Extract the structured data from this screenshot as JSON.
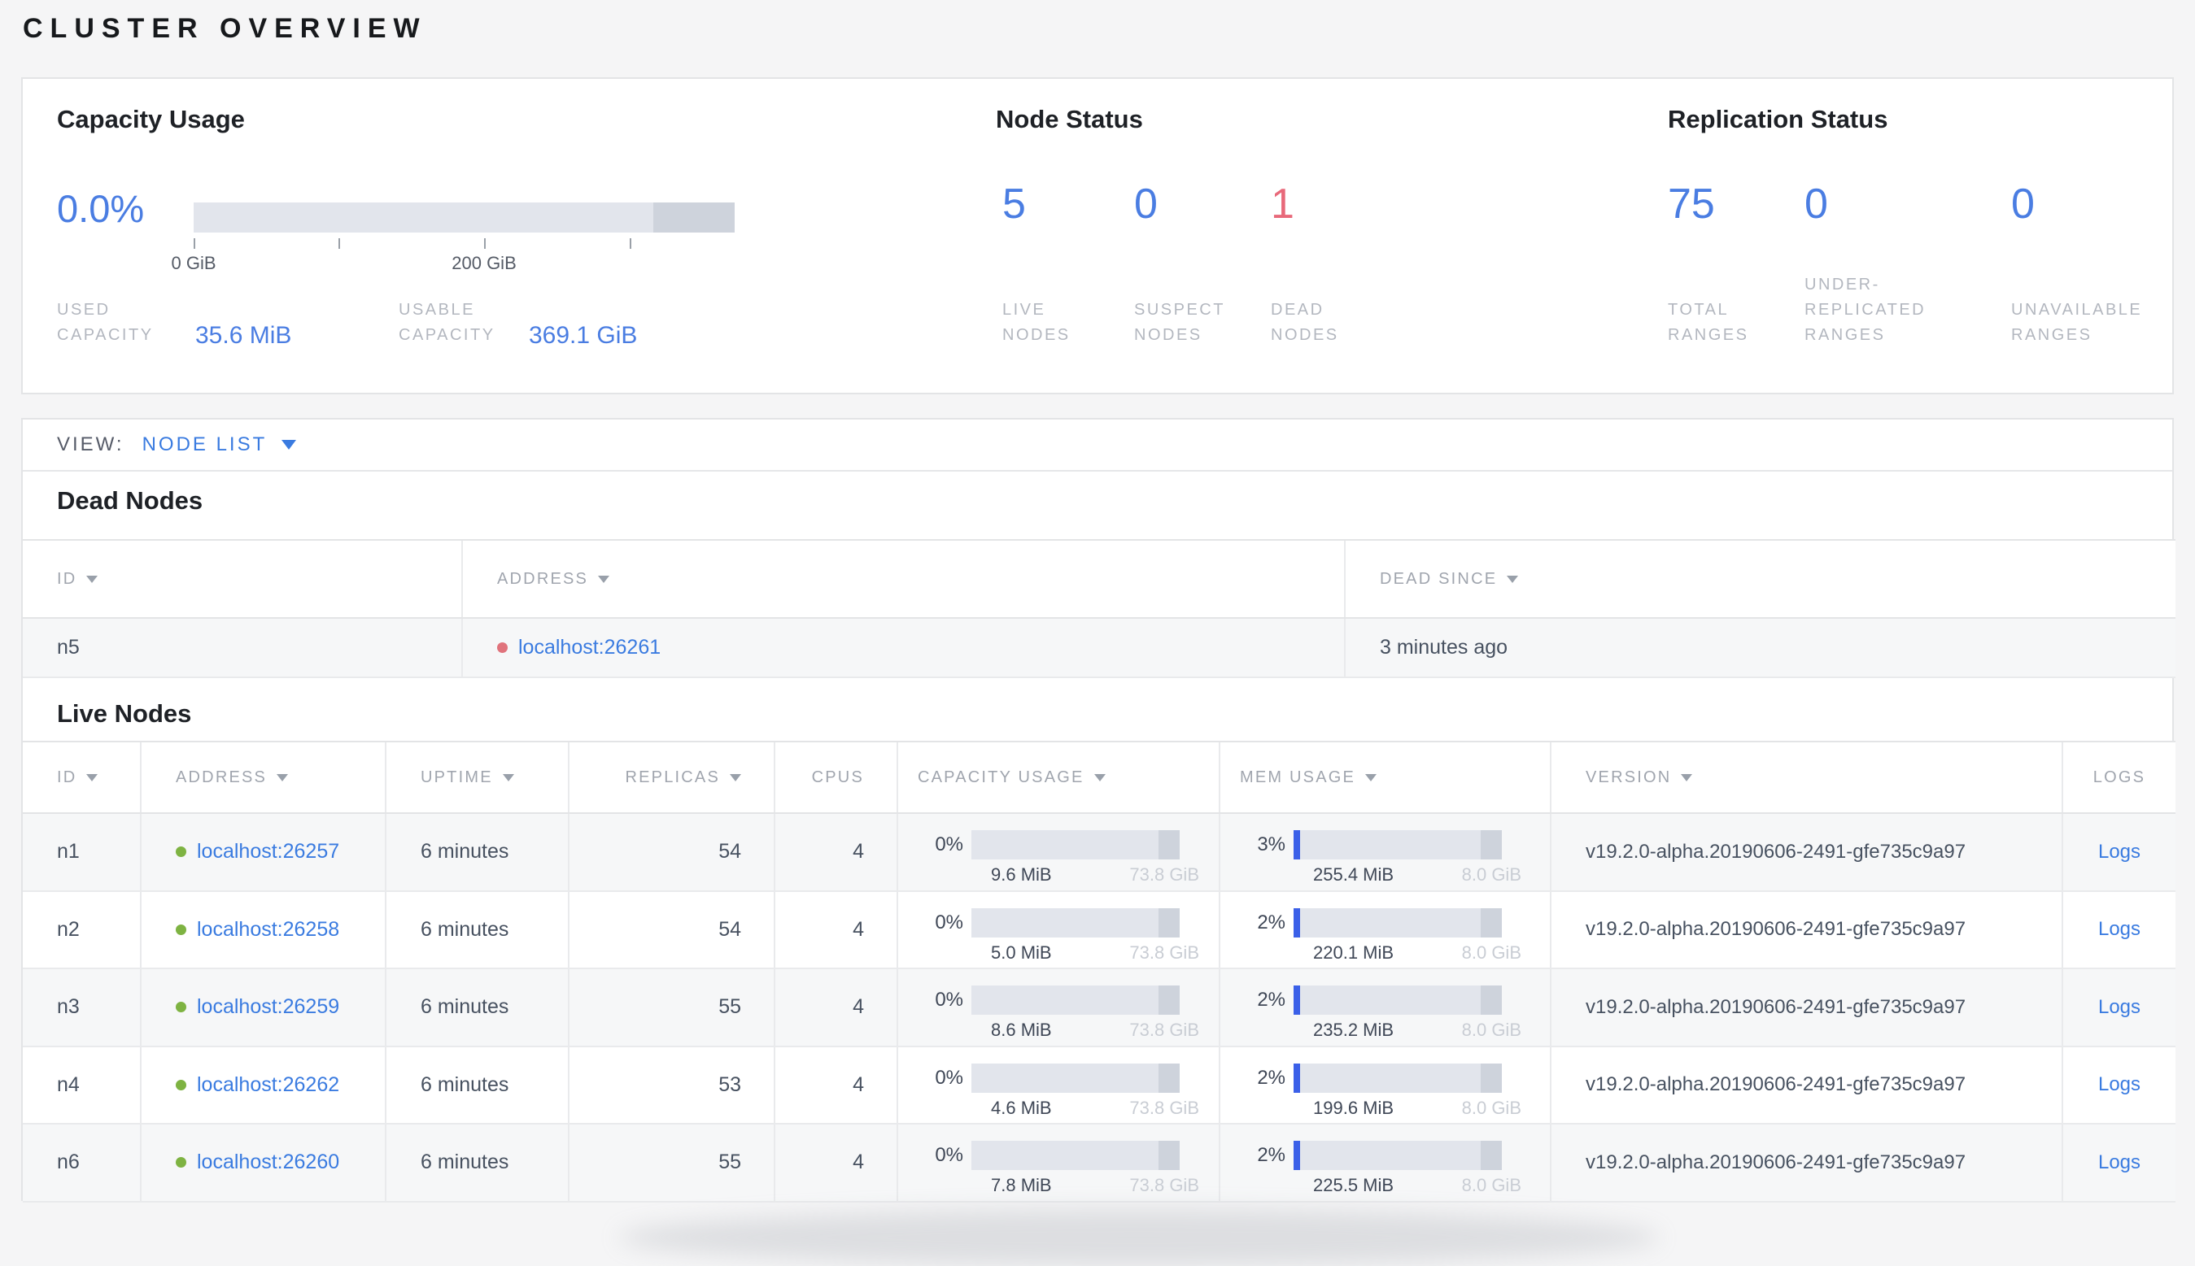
{
  "colors": {
    "accent_blue": "#4a7de2",
    "link_blue": "#3a7be0",
    "danger_red": "#e8697a",
    "live_green": "#7eb342",
    "dead_red": "#e0737c"
  },
  "page_title": "CLUSTER OVERVIEW",
  "summary": {
    "capacity": {
      "title": "Capacity Usage",
      "percent": "0.0%",
      "tick_labels": [
        "0 GiB",
        "200 GiB"
      ],
      "stats": [
        {
          "label": "USED CAPACITY",
          "value": "35.6 MiB"
        },
        {
          "label": "USABLE CAPACITY",
          "value": "369.1 GiB"
        }
      ]
    },
    "node_status": {
      "title": "Node Status",
      "stats": [
        {
          "value": "5",
          "label": "LIVE NODES"
        },
        {
          "value": "0",
          "label": "SUSPECT NODES"
        },
        {
          "value": "1",
          "label": "DEAD NODES"
        }
      ]
    },
    "replication": {
      "title": "Replication Status",
      "stats": [
        {
          "value": "75",
          "label": "TOTAL RANGES"
        },
        {
          "value": "0",
          "label": "UNDER-REPLICATED RANGES"
        },
        {
          "value": "0",
          "label": "UNAVAILABLE RANGES"
        }
      ]
    }
  },
  "view_bar": {
    "label": "VIEW:",
    "selected": "NODE LIST"
  },
  "dead_nodes": {
    "title": "Dead Nodes",
    "columns": [
      "ID",
      "ADDRESS",
      "DEAD SINCE"
    ],
    "rows": [
      {
        "id": "n5",
        "address": "localhost:26261",
        "dead_since": "3 minutes ago"
      }
    ]
  },
  "live_nodes": {
    "title": "Live Nodes",
    "columns": [
      "ID",
      "ADDRESS",
      "UPTIME",
      "REPLICAS",
      "CPUS",
      "CAPACITY USAGE",
      "MEM USAGE",
      "VERSION",
      "LOGS"
    ],
    "rows": [
      {
        "id": "n1",
        "address": "localhost:26257",
        "uptime": "6 minutes",
        "replicas": "54",
        "cpus": "4",
        "capacity_percent": "0%",
        "capacity_used": "9.6 MiB",
        "capacity_total": "73.8 GiB",
        "mem_percent": "3%",
        "mem_used": "255.4 MiB",
        "mem_total": "8.0 GiB",
        "version": "v19.2.0-alpha.20190606-2491-gfe735c9a97",
        "logs": "Logs"
      },
      {
        "id": "n2",
        "address": "localhost:26258",
        "uptime": "6 minutes",
        "replicas": "54",
        "cpus": "4",
        "capacity_percent": "0%",
        "capacity_used": "5.0 MiB",
        "capacity_total": "73.8 GiB",
        "mem_percent": "2%",
        "mem_used": "220.1 MiB",
        "mem_total": "8.0 GiB",
        "version": "v19.2.0-alpha.20190606-2491-gfe735c9a97",
        "logs": "Logs"
      },
      {
        "id": "n3",
        "address": "localhost:26259",
        "uptime": "6 minutes",
        "replicas": "55",
        "cpus": "4",
        "capacity_percent": "0%",
        "capacity_used": "8.6 MiB",
        "capacity_total": "73.8 GiB",
        "mem_percent": "2%",
        "mem_used": "235.2 MiB",
        "mem_total": "8.0 GiB",
        "version": "v19.2.0-alpha.20190606-2491-gfe735c9a97",
        "logs": "Logs"
      },
      {
        "id": "n4",
        "address": "localhost:26262",
        "uptime": "6 minutes",
        "replicas": "53",
        "cpus": "4",
        "capacity_percent": "0%",
        "capacity_used": "4.6 MiB",
        "capacity_total": "73.8 GiB",
        "mem_percent": "2%",
        "mem_used": "199.6 MiB",
        "mem_total": "8.0 GiB",
        "version": "v19.2.0-alpha.20190606-2491-gfe735c9a97",
        "logs": "Logs"
      },
      {
        "id": "n6",
        "address": "localhost:26260",
        "uptime": "6 minutes",
        "replicas": "55",
        "cpus": "4",
        "capacity_percent": "0%",
        "capacity_used": "7.8 MiB",
        "capacity_total": "73.8 GiB",
        "mem_percent": "2%",
        "mem_used": "225.5 MiB",
        "mem_total": "8.0 GiB",
        "version": "v19.2.0-alpha.20190606-2491-gfe735c9a97",
        "logs": "Logs"
      }
    ]
  }
}
